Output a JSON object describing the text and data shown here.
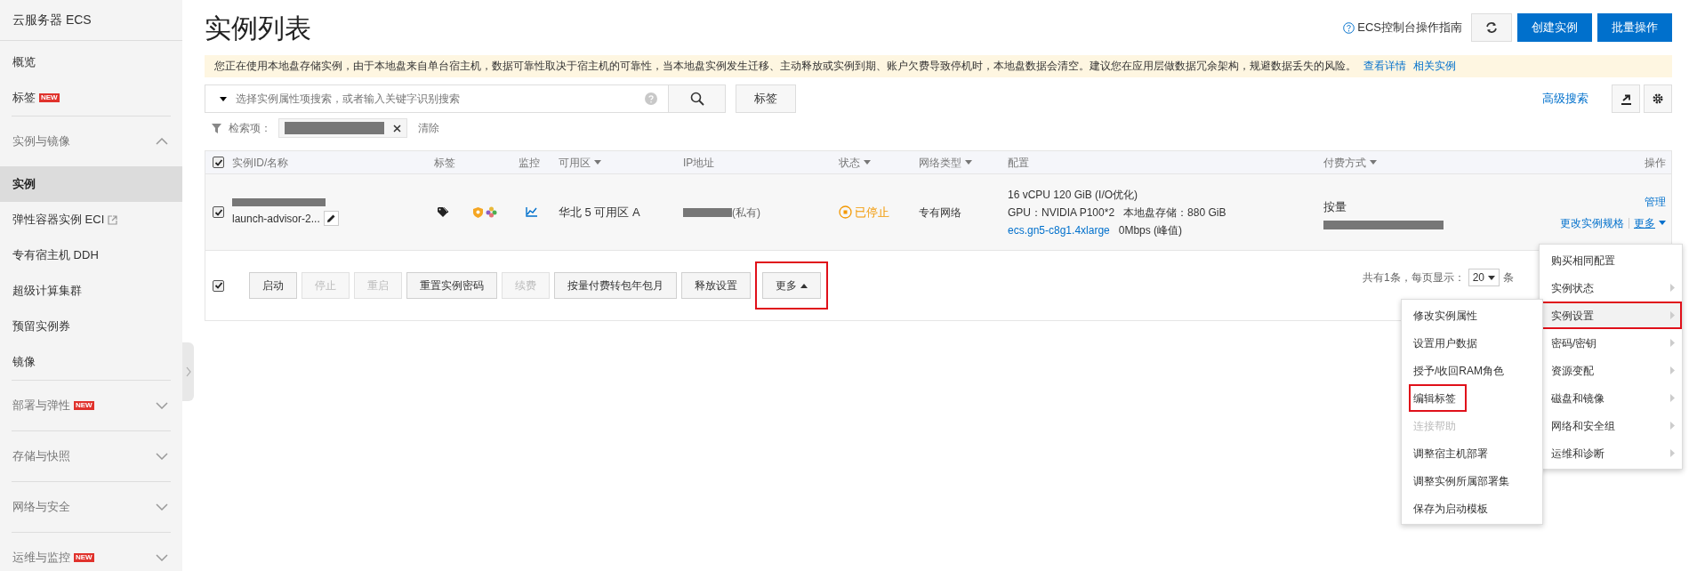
{
  "sidebar": {
    "title": "云服务器 ECS",
    "items": [
      {
        "kind": "link",
        "label": "概览",
        "selected": false
      },
      {
        "kind": "link",
        "label": "标签",
        "badge": "NEW",
        "selected": false
      },
      {
        "kind": "group",
        "label": "实例与镜像",
        "expanded": true
      },
      {
        "kind": "link",
        "label": "实例",
        "selected": true
      },
      {
        "kind": "external_link",
        "label": "弹性容器实例 ECI",
        "selected": false
      },
      {
        "kind": "link",
        "label": "专有宿主机 DDH",
        "selected": false
      },
      {
        "kind": "link",
        "label": "超级计算集群",
        "selected": false
      },
      {
        "kind": "link",
        "label": "预留实例券",
        "selected": false
      },
      {
        "kind": "link",
        "label": "镜像",
        "selected": false
      },
      {
        "kind": "group",
        "label": "部署与弹性",
        "badge": "NEW",
        "expanded": false
      },
      {
        "kind": "group",
        "label": "存储与快照",
        "expanded": false
      },
      {
        "kind": "group",
        "label": "网络与安全",
        "expanded": false
      },
      {
        "kind": "group",
        "label": "运维与监控",
        "badge": "NEW",
        "expanded": false
      }
    ]
  },
  "header": {
    "title": "实例列表",
    "guide_link": "ECS控制台操作指南",
    "buttons": [
      "创建实例",
      "批量操作"
    ]
  },
  "banner": {
    "text": "您正在使用本地盘存储实例，由于本地盘来自单台宿主机，数据可靠性取决于宿主机的可靠性，当本地盘实例发生迁移、主动释放或实例到期、账户欠费导致停机时，本地盘数据会清空。建议您在应用层做数据冗余架构，规避数据丢失的风险。",
    "links": [
      "查看详情",
      "相关实例"
    ]
  },
  "search": {
    "placeholder": "选择实例属性项搜索，或者输入关键字识别搜索",
    "tag_button": "标签",
    "advanced_search": "高级搜索"
  },
  "filter": {
    "label": "检索项：",
    "clear": "清除"
  },
  "table": {
    "select_all": true,
    "columns": [
      {
        "label": "实例ID/名称",
        "sortable": false
      },
      {
        "label": "标签",
        "sortable": false
      },
      {
        "label": "监控",
        "sortable": false
      },
      {
        "label": "可用区",
        "sortable": true
      },
      {
        "label": "IP地址",
        "sortable": false
      },
      {
        "label": "状态",
        "sortable": true
      },
      {
        "label": "网络类型",
        "sortable": true
      },
      {
        "label": "配置",
        "sortable": false
      },
      {
        "label": "付费方式",
        "sortable": true
      },
      {
        "label": "操作",
        "sortable": false
      }
    ],
    "rows": [
      {
        "checked": true,
        "name": "launch-advisor-2...",
        "zone": "华北 5 可用区 A",
        "ip_note": "(私有)",
        "status": "已停止",
        "network": "专有网络",
        "config_lines": [
          "16 vCPU 120 GiB (I/O优化)",
          "GPU：NVIDIA P100*2   本地盘存储：880 GiB"
        ],
        "instance_type": "ecs.gn5-c8g1.4xlarge",
        "bandwidth": "0Mbps (峰值)",
        "billing": "按量",
        "actions": {
          "manage": "管理",
          "change": "更改实例规格",
          "more": "更多"
        }
      }
    ]
  },
  "bulk": {
    "checked": true,
    "buttons": [
      {
        "kind": "button",
        "label": "启动",
        "disabled": false,
        "highlighted": false
      },
      {
        "kind": "button",
        "label": "停止",
        "disabled": true,
        "highlighted": false
      },
      {
        "kind": "button",
        "label": "重启",
        "disabled": true,
        "highlighted": false
      },
      {
        "kind": "button",
        "label": "重置实例密码",
        "disabled": false,
        "highlighted": false
      },
      {
        "kind": "button",
        "label": "续费",
        "disabled": true,
        "highlighted": false
      },
      {
        "kind": "button",
        "label": "按量付费转包年包月",
        "disabled": false,
        "highlighted": false
      },
      {
        "kind": "button",
        "label": "释放设置",
        "disabled": false,
        "highlighted": false
      },
      {
        "kind": "dropdown",
        "label": "更多",
        "disabled": false,
        "highlighted": true
      }
    ]
  },
  "pagination": {
    "total": "共有1条，每页显示：",
    "page_size": "20",
    "unit": "条"
  },
  "more_menu": [
    {
      "label": "购买相同配置",
      "submenu": false,
      "selected": false,
      "highlighted": false
    },
    {
      "label": "实例状态",
      "submenu": true,
      "selected": false,
      "highlighted": false
    },
    {
      "label": "实例设置",
      "submenu": true,
      "selected": true,
      "highlighted": true
    },
    {
      "label": "密码/密钥",
      "submenu": true,
      "selected": false,
      "highlighted": false
    },
    {
      "label": "资源变配",
      "submenu": true,
      "selected": false,
      "highlighted": false
    },
    {
      "label": "磁盘和镜像",
      "submenu": true,
      "selected": false,
      "highlighted": false
    },
    {
      "label": "网络和安全组",
      "submenu": true,
      "selected": false,
      "highlighted": false
    },
    {
      "label": "运维和诊断",
      "submenu": true,
      "selected": false,
      "highlighted": false
    }
  ],
  "submenu": [
    {
      "label": "修改实例属性",
      "disabled": false,
      "highlighted": false
    },
    {
      "label": "设置用户数据",
      "disabled": false,
      "highlighted": false
    },
    {
      "label": "授予/收回RAM角色",
      "disabled": false,
      "highlighted": false
    },
    {
      "label": "编辑标签",
      "disabled": false,
      "highlighted": true
    },
    {
      "label": "连接帮助",
      "disabled": true,
      "highlighted": false
    },
    {
      "label": "调整宿主机部署",
      "disabled": false,
      "highlighted": false
    },
    {
      "label": "调整实例所属部署集",
      "disabled": false,
      "highlighted": false
    },
    {
      "label": "保存为启动模板",
      "disabled": false,
      "highlighted": false
    }
  ]
}
